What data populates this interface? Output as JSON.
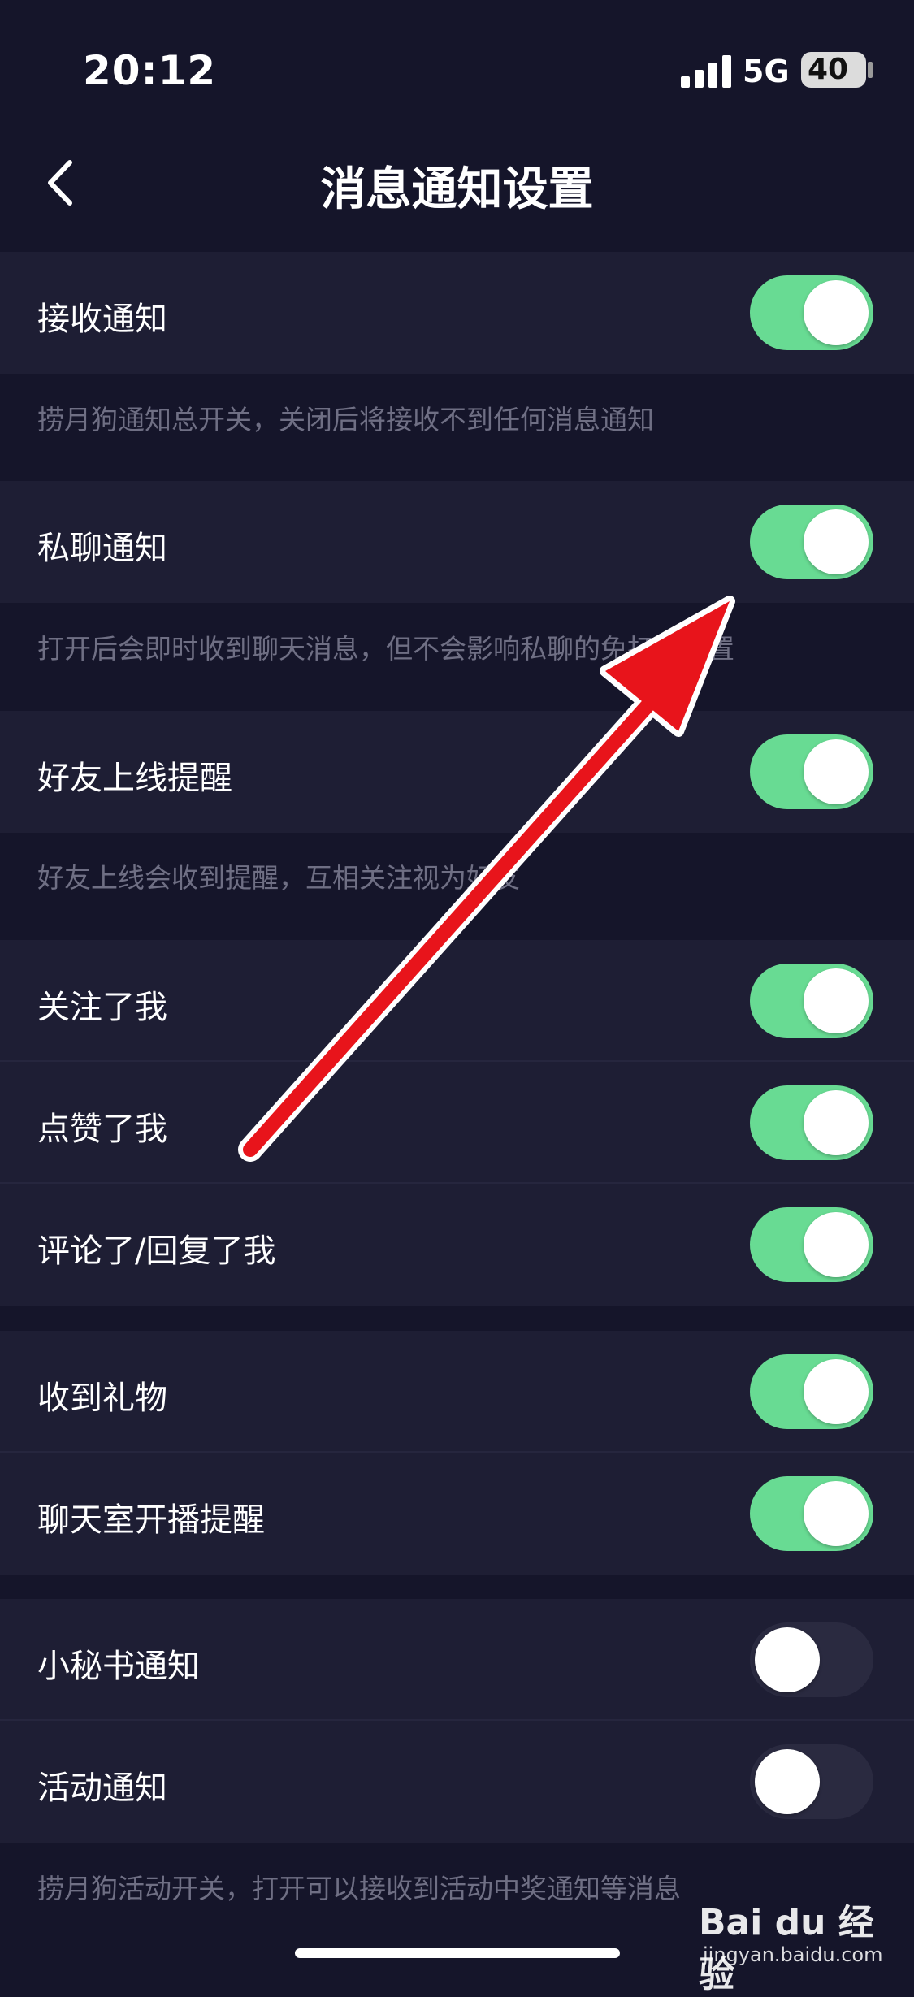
{
  "status_bar": {
    "time": "20:12",
    "network": "5G",
    "battery": "40"
  },
  "header": {
    "title": "消息通知设置",
    "back_icon": "chevron-left-icon"
  },
  "settings": {
    "receive": {
      "label": "接收通知",
      "on": true,
      "description": "捞月狗通知总开关，关闭后将接收不到任何消息通知"
    },
    "private_chat": {
      "label": "私聊通知",
      "on": true,
      "description": "打开后会即时收到聊天消息，但不会影响私聊的免打扰设置"
    },
    "friend_online": {
      "label": "好友上线提醒",
      "on": true,
      "description": "好友上线会收到提醒，互相关注视为好友"
    },
    "followed_me": {
      "label": "关注了我",
      "on": true
    },
    "liked_me": {
      "label": "点赞了我",
      "on": true
    },
    "commented_me": {
      "label": "评论了/回复了我",
      "on": true
    },
    "gift": {
      "label": "收到礼物",
      "on": true
    },
    "chatroom_live": {
      "label": "聊天室开播提醒",
      "on": true
    },
    "secretary": {
      "label": "小秘书通知",
      "on": false
    },
    "activity": {
      "label": "活动通知",
      "on": false,
      "description": "捞月狗活动开关，打开可以接收到活动中奖通知等消息"
    }
  },
  "watermark": {
    "logo": "Bai du 经验",
    "url": "jingyan.baidu.com"
  },
  "colors": {
    "background": "#15152a",
    "row": "#1e1e34",
    "toggle_on": "#68db93",
    "toggle_off": "#2a2a40",
    "annotation_arrow": "#e8141b"
  }
}
